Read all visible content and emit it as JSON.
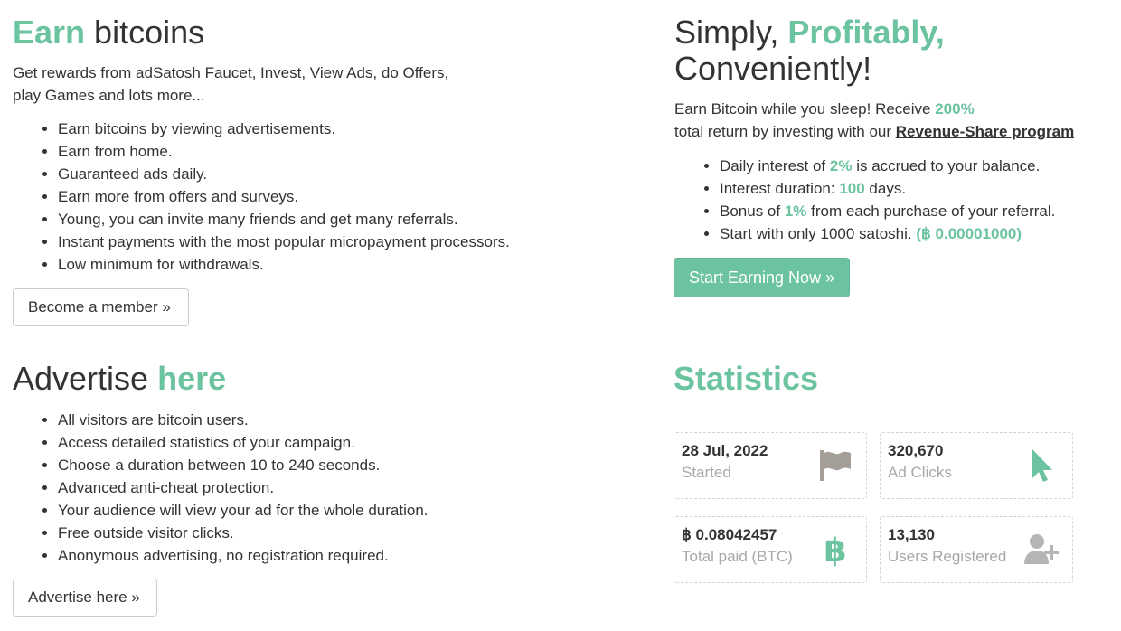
{
  "earn": {
    "heading_accent": "Earn",
    "heading_rest": " bitcoins",
    "intro_line1": "Get rewards from adSatosh Faucet, Invest, View Ads, do Offers,",
    "intro_line2": "play Games and lots more...",
    "items": [
      "Earn bitcoins by viewing advertisements.",
      "Earn from home.",
      "Guaranteed ads daily.",
      "Earn more from offers and surveys.",
      "Young, you can invite many friends and get many referrals.",
      "Instant payments with the most popular micropayment processors.",
      "Low minimum for withdrawals."
    ],
    "button": "Become a member »"
  },
  "invest": {
    "heading_part1": "Simply, ",
    "heading_accent": "Profitably,",
    "heading_part2": "Conveniently!",
    "text_a": "Earn Bitcoin while you sleep! Receive ",
    "text_a_accent": "200%",
    "text_b": "total return by investing with our ",
    "link": "Revenue-Share program",
    "items": [
      {
        "pre": "Daily interest of ",
        "accent": "2%",
        "post": " is accrued to your balance."
      },
      {
        "pre": "Interest duration: ",
        "accent": "100",
        "post": " days."
      },
      {
        "pre": "Bonus of ",
        "accent": "1%",
        "post": " from each purchase of your referral."
      },
      {
        "pre": "Start with only 1000 satoshi. ",
        "accent": "(฿ 0.00001000)",
        "post": ""
      }
    ],
    "button": "Start Earning Now »"
  },
  "advertise": {
    "heading_rest": "Advertise ",
    "heading_accent": "here",
    "items": [
      "All visitors are bitcoin users.",
      "Access detailed statistics of your campaign.",
      "Choose a duration between 10 to 240 seconds.",
      "Advanced anti-cheat protection.",
      "Your audience will view your ad for the whole duration.",
      "Free outside visitor clicks.",
      "Anonymous advertising, no registration required."
    ],
    "button": "Advertise here »"
  },
  "statistics": {
    "heading": "Statistics",
    "cards": [
      {
        "value": "28 Jul, 2022",
        "label": "Started",
        "icon": "flag-icon"
      },
      {
        "value": "320,670",
        "label": "Ad Clicks",
        "icon": "cursor-icon"
      },
      {
        "value": "฿ 0.08042457",
        "label": "Total paid (BTC)",
        "icon": "bitcoin-icon"
      },
      {
        "value": "13,130",
        "label": "Users Registered",
        "icon": "user-plus-icon"
      }
    ]
  },
  "colors": {
    "accent": "#6cc3a0",
    "text": "#333333",
    "muted": "#a8a8a8",
    "icon_gray": "#a39e98"
  }
}
